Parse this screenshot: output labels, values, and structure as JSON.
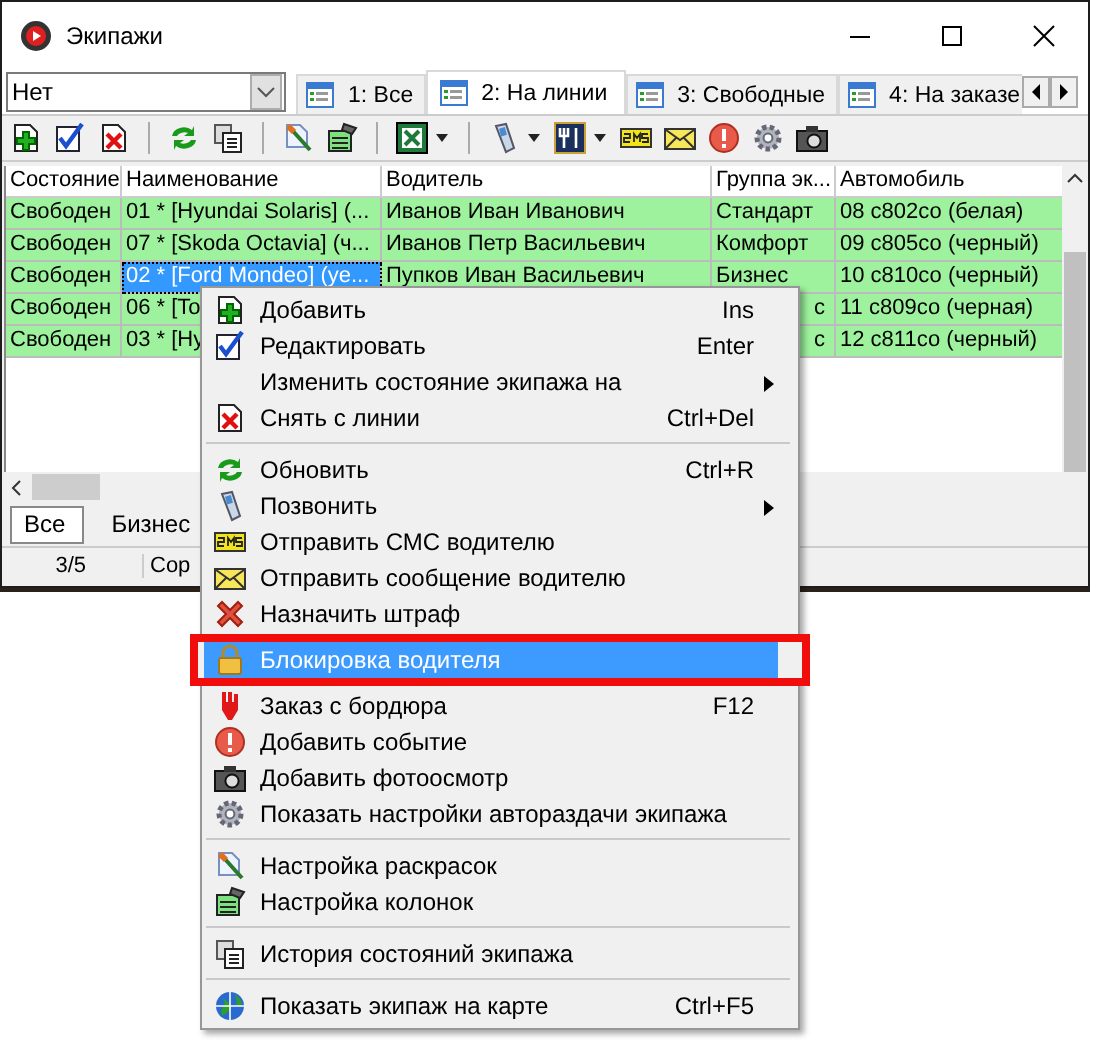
{
  "window": {
    "title": "Экипажи"
  },
  "filter": {
    "value": "Нет"
  },
  "tabs": [
    {
      "label": "1: Все",
      "selected": false
    },
    {
      "label": "2: На линии",
      "selected": true
    },
    {
      "label": "3: Свободные",
      "selected": false
    },
    {
      "label": "4: На заказе",
      "selected": false
    }
  ],
  "table": {
    "columns": [
      "Состояние",
      "Наименование",
      "Водитель",
      "Группа эк...",
      "Автомобиль"
    ],
    "rows": [
      {
        "cells": [
          "Свободен",
          "01 * [Hyundai Solaris] (...",
          "Иванов Иван Иванович",
          "Стандарт",
          "08 с802со (белая)"
        ],
        "selected": false
      },
      {
        "cells": [
          "Свободен",
          "07 * [Skoda Octavia] (ч...",
          "Иванов Петр Васильевич",
          "Комфорт",
          "09 с805со (черный)"
        ],
        "selected": false
      },
      {
        "cells": [
          "Свободен",
          "02 * [Ford Mondeo] (ye...",
          "Пупков Иван Васильевич",
          "Бизнес",
          "10 с810со (черный)"
        ],
        "selected": true
      },
      {
        "cells": [
          "Свободен",
          "06 * [To",
          "",
          "с",
          "11 с809со (черная)"
        ],
        "selected": false
      },
      {
        "cells": [
          "Свободен",
          "03 * [Hy",
          "",
          "с",
          "12 с811со (черный)"
        ],
        "selected": false
      }
    ]
  },
  "group_tabs": [
    {
      "label": "Все",
      "selected": true
    },
    {
      "label": "Бизнес",
      "selected": false
    }
  ],
  "status_bar": [
    "3/5",
    "Сор"
  ],
  "context_menu": [
    {
      "kind": "item",
      "label": "Добавить",
      "shortcut": "Ins",
      "submenu": false,
      "selected": false,
      "annotated": false
    },
    {
      "kind": "item",
      "label": "Редактировать",
      "shortcut": "Enter",
      "submenu": false,
      "selected": false,
      "annotated": false
    },
    {
      "kind": "item",
      "label": "Изменить состояние экипажа на",
      "submenu": true,
      "selected": false,
      "annotated": false
    },
    {
      "kind": "item",
      "label": "Снять с линии",
      "shortcut": "Ctrl+Del",
      "submenu": false,
      "selected": false,
      "annotated": false
    },
    {
      "kind": "separator"
    },
    {
      "kind": "item",
      "label": "Обновить",
      "shortcut": "Ctrl+R",
      "submenu": false,
      "selected": false,
      "annotated": false
    },
    {
      "kind": "item",
      "label": "Позвонить",
      "submenu": true,
      "selected": false,
      "annotated": false
    },
    {
      "kind": "item",
      "label": "Отправить СМС водителю",
      "submenu": false,
      "selected": false,
      "annotated": false
    },
    {
      "kind": "item",
      "label": "Отправить сообщение водителю",
      "submenu": false,
      "selected": false,
      "annotated": false
    },
    {
      "kind": "item",
      "label": "Назначить штраф",
      "submenu": false,
      "selected": false,
      "annotated": false
    },
    {
      "kind": "item",
      "label": "Блокировка водителя",
      "submenu": false,
      "selected": true,
      "annotated": true
    },
    {
      "kind": "item",
      "label": "Заказ с бордюра",
      "shortcut": "F12",
      "submenu": false,
      "selected": false,
      "annotated": false
    },
    {
      "kind": "item",
      "label": "Добавить событие",
      "submenu": false,
      "selected": false,
      "annotated": false
    },
    {
      "kind": "item",
      "label": "Добавить фотоосмотр",
      "submenu": false,
      "selected": false,
      "annotated": false
    },
    {
      "kind": "item",
      "label": "Показать настройки автораздачи экипажа",
      "submenu": false,
      "selected": false,
      "annotated": false
    },
    {
      "kind": "separator"
    },
    {
      "kind": "item",
      "label": "Настройка раскрасок",
      "submenu": false,
      "selected": false,
      "annotated": false
    },
    {
      "kind": "item",
      "label": "Настройка колонок",
      "submenu": false,
      "selected": false,
      "annotated": false
    },
    {
      "kind": "separator"
    },
    {
      "kind": "item",
      "label": "История состояний экипажа",
      "submenu": false,
      "selected": false,
      "annotated": false
    },
    {
      "kind": "separator"
    },
    {
      "kind": "item",
      "label": "Показать экипаж на карте",
      "shortcut": "Ctrl+F5",
      "submenu": false,
      "selected": false,
      "annotated": false
    }
  ]
}
